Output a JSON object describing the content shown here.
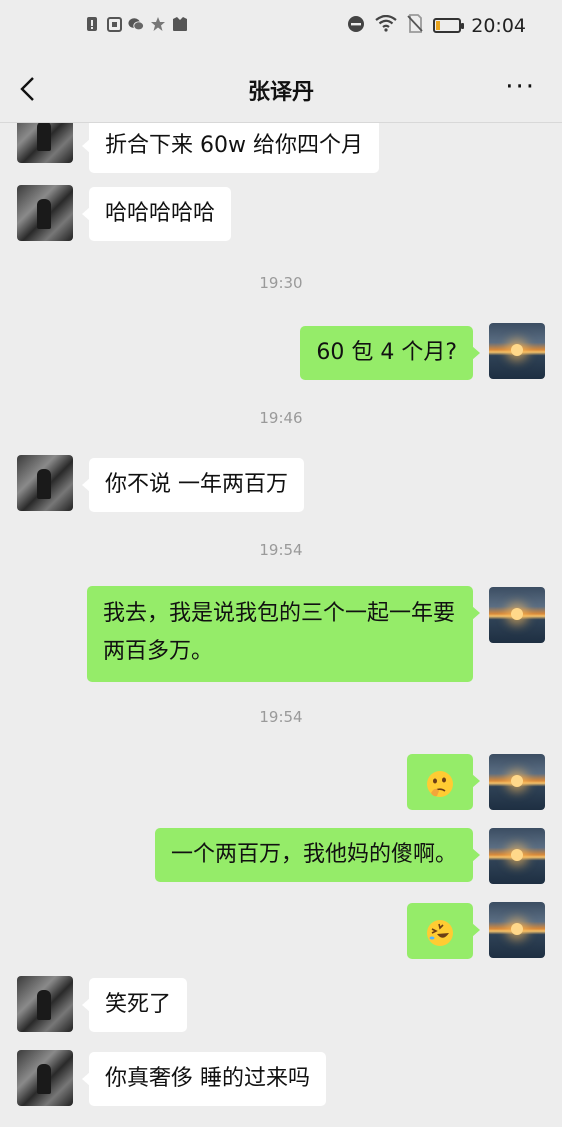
{
  "status_bar": {
    "left_icons": [
      "alert-icon",
      "sim-icon",
      "wechat-icon",
      "star-icon",
      "bag-icon"
    ],
    "right_icons": [
      "dnd-icon",
      "wifi-icon",
      "no-sim-icon",
      "battery-icon"
    ],
    "time": "20:04",
    "battery_level": 0.2
  },
  "header": {
    "title": "张译丹",
    "more": "···"
  },
  "messages": [
    {
      "side": "left",
      "text": "折合下来 60w 给你四个月"
    },
    {
      "side": "left",
      "text": "哈哈哈哈哈"
    },
    {
      "type": "time",
      "text": "19:30"
    },
    {
      "side": "right",
      "text": "60 包 4 个月?"
    },
    {
      "type": "time",
      "text": "19:46"
    },
    {
      "side": "left",
      "text": "你不说 一年两百万"
    },
    {
      "type": "time",
      "text": "19:54"
    },
    {
      "side": "right",
      "text": "我去，我是说我包的三个一起一年要两百多万。"
    },
    {
      "type": "time",
      "text": "19:54"
    },
    {
      "side": "right",
      "emoji": "thinking-face-emoji"
    },
    {
      "side": "right",
      "text": "一个两百万，我他妈的傻啊。"
    },
    {
      "side": "right",
      "emoji": "rolling-laughing-emoji"
    },
    {
      "side": "left",
      "text": "笑死了"
    },
    {
      "side": "left",
      "text": "你真奢侈 睡的过来吗"
    }
  ]
}
